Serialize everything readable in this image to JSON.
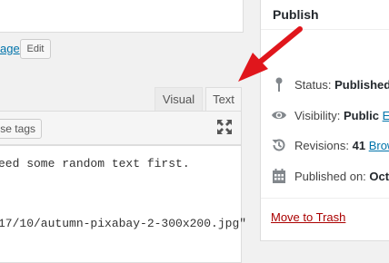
{
  "permalink": {
    "link_text": "age",
    "edit_label": "Edit"
  },
  "editor": {
    "tabs": {
      "visual": "Visual",
      "text": "Text"
    },
    "toolbar": {
      "close_tags_label": "ose tags",
      "fullscreen_icon": "fullscreen-icon"
    },
    "content_lines": [
      "eed some random text first.",
      "17/10/autumn-pixabay-2-300x200.jpg\""
    ]
  },
  "publish": {
    "title": "Publish",
    "status": {
      "label": "Status:",
      "value": "Published",
      "link": "E",
      "icon": "pin-icon"
    },
    "visibility": {
      "label": "Visibility:",
      "value": "Public",
      "link": "Ed",
      "icon": "eye-icon"
    },
    "revisions": {
      "label": "Revisions:",
      "value": "41",
      "link": "Brow",
      "icon": "revisions-icon"
    },
    "published_on": {
      "label": "Published on:",
      "value": "Oct",
      "icon": "calendar-icon"
    },
    "move_to_trash": "Move to Trash"
  },
  "colors": {
    "link": "#0073aa",
    "trash": "#a00000",
    "annotation_arrow": "#e0161c"
  }
}
